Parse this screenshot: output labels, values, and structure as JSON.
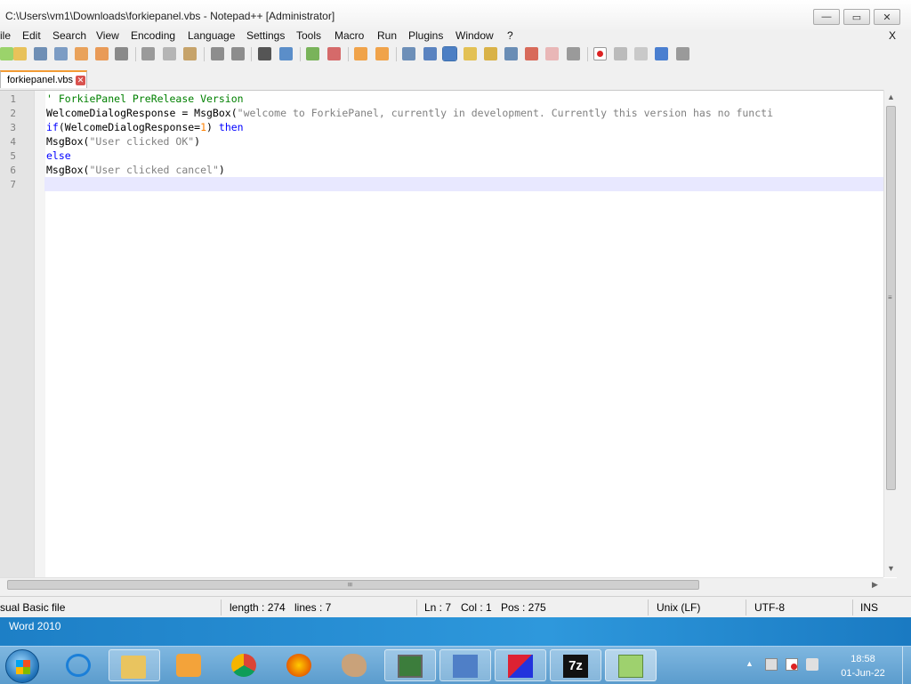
{
  "window": {
    "title": "C:\\Users\\vm1\\Downloads\\forkiepanel.vbs - Notepad++ [Administrator]",
    "minimize_glyph": "—",
    "maximize_glyph": "▭",
    "close_glyph": "✕"
  },
  "menu": {
    "items": [
      "ile",
      "Edit",
      "Search",
      "View",
      "Encoding",
      "Language",
      "Settings",
      "Tools",
      "Macro",
      "Run",
      "Plugins",
      "Window",
      "?"
    ],
    "close_glyph": "X"
  },
  "toolbar": {
    "icons": [
      "new-file-icon",
      "open-file-icon",
      "save-icon",
      "save-all-icon",
      "close-icon",
      "close-all-icon",
      "print-icon",
      "cut-icon",
      "copy-icon",
      "paste-icon",
      "undo-icon",
      "redo-icon",
      "find-icon",
      "replace-icon",
      "zoom-in-icon",
      "zoom-out-icon",
      "sync-vertical-icon",
      "sync-horizontal-icon",
      "word-wrap-icon",
      "show-all-chars-icon",
      "indent-guide-icon",
      "user-language-icon",
      "doc-map-icon",
      "function-list-icon",
      "folder-workspace-icon",
      "monitoring-icon",
      "record-macro-icon",
      "stop-macro-icon",
      "play-macro-icon",
      "run-macro-multiple-icon",
      "save-macro-icon"
    ]
  },
  "tab": {
    "name": "forkiepanel.vbs",
    "close_glyph": "✕"
  },
  "editor": {
    "line_numbers": [
      "1",
      "2",
      "3",
      "4",
      "5",
      "6",
      "7"
    ],
    "lines": {
      "l1": "' ForkiePanel PreRelease Version",
      "l2_ident": "WelcomeDialogResponse = MsgBox(",
      "l2_str": "\"welcome to ForkiePanel, currently in development. Currently this version has no functi",
      "l3_kw1": "if",
      "l3_mid": "(WelcomeDialogResponse=",
      "l3_num": "1",
      "l3_close": ") ",
      "l3_kw2": "then",
      "l4_ident": "MsgBox(",
      "l4_str": "\"User clicked OK\"",
      "l4_close": ")",
      "l5_kw": "else",
      "l6_ident": "MsgBox(",
      "l6_str": "\"User clicked cancel\"",
      "l6_close": ")"
    }
  },
  "scroll": {
    "up": "▲",
    "down": "▼",
    "left": "◀",
    "right": "▶",
    "grip": "≡"
  },
  "status": {
    "filetype": "sual Basic file",
    "length": "length : 274",
    "lines": "lines : 7",
    "ln": "Ln : 7",
    "col": "Col : 1",
    "pos": "Pos : 275",
    "eol": "Unix (LF)",
    "encoding": "UTF-8",
    "mode": "INS"
  },
  "desktop": {
    "label": "Word 2010"
  },
  "taskbar": {
    "apps": [
      "internet-explorer-icon",
      "file-explorer-icon",
      "media-player-icon",
      "chrome-icon",
      "firefox-icon",
      "paint-icon",
      "task-manager-icon",
      "on-screen-keyboard-icon",
      "cube-app-icon",
      "sevenzip-icon",
      "notepad-plus-plus-icon"
    ],
    "sevenzip_label": "7z",
    "time": "18:58",
    "date": "01-Jun-22"
  }
}
